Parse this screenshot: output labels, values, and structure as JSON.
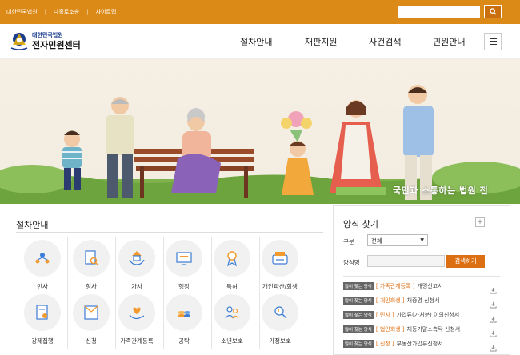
{
  "topbar": {
    "links": [
      "대한민국법원",
      "나홀로소송",
      "사이트맵"
    ],
    "search_placeholder": ""
  },
  "header": {
    "logo_small": "대한민국법원",
    "logo_big": "전자민원센터",
    "nav": [
      "절차안내",
      "재판지원",
      "사건검색",
      "민원안내"
    ]
  },
  "banner": {
    "text": "국민과 소통하는 법원 전"
  },
  "procedures": {
    "title": "절차안내",
    "items": [
      {
        "label": "민사",
        "icon": "people-network-icon"
      },
      {
        "label": "형사",
        "icon": "document-search-icon"
      },
      {
        "label": "가사",
        "icon": "house-hands-icon"
      },
      {
        "label": "행정",
        "icon": "monitor-document-icon"
      },
      {
        "label": "특허",
        "icon": "award-ribbon-icon"
      },
      {
        "label": "개인파산/회생",
        "icon": "wallet-cards-icon"
      },
      {
        "label": "강제집행",
        "icon": "document-stamp-icon"
      },
      {
        "label": "신청",
        "icon": "envelope-form-icon"
      },
      {
        "label": "가족관계등록",
        "icon": "heart-hand-icon"
      },
      {
        "label": "공탁",
        "icon": "coin-stack-icon"
      },
      {
        "label": "소년보호",
        "icon": "family-icon"
      },
      {
        "label": "가정보호",
        "icon": "person-shield-icon"
      }
    ]
  },
  "forms": {
    "title": "양식 찾기",
    "plus": "+",
    "category_label": "구분",
    "category_value": "전체",
    "name_label": "양식명",
    "search_button": "검색하기",
    "badge": "많이 찾는 양식",
    "rows": [
      {
        "category": "[ 가족관계등록 ]",
        "name": "개명신고서"
      },
      {
        "category": "[ 개인회생 ]",
        "name": "채증명 신청서"
      },
      {
        "category": "[ 민사 ]",
        "name": "가압류(가처분) 이의신청서"
      },
      {
        "category": "[ 법인회생 ]",
        "name": "채등기말소촉탁 신청서"
      },
      {
        "category": "[ 신청 ]",
        "name": "부동산가압류신청서"
      }
    ]
  },
  "colors": {
    "accent": "#dc8a17",
    "button": "#dc6f12"
  }
}
